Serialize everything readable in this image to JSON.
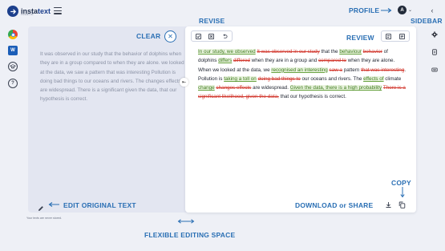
{
  "brand": {
    "name_a": "insta",
    "name_b": "text",
    "sub": "PREMIUM"
  },
  "header": {
    "profile_label": "PROFILE",
    "avatar_initial": "A",
    "sidebar_label": "SIDEBAR"
  },
  "editor": {
    "clear_label": "CLEAR",
    "original_text": "It was observed in our study that the behavior of dolphins when they are in a group compared to when they are alone. we looked at the data, we saw a pattern that was interesting Pollution is doing bad things to our oceans and rivers. The changes effects are widespread. There is a significant given the data, that our hypothesis is correct.",
    "edit_label": "EDIT ORIGINAL TEXT",
    "footnote": "Your texts are never stored.",
    "flex_label": "FLEXIBLE EDITING SPACE"
  },
  "review": {
    "revise_label": "REVISE",
    "review_label": "REVIEW",
    "copy_label": "COPY",
    "download_label": "DOWNLOAD or SHARE",
    "segments": [
      {
        "t": "In our study, we observed",
        "k": "add"
      },
      {
        "t": " ",
        "k": "n"
      },
      {
        "t": "It was observed in our study",
        "k": "del"
      },
      {
        "t": " that the ",
        "k": "n"
      },
      {
        "t": "behaviour",
        "k": "add"
      },
      {
        "t": " ",
        "k": "n"
      },
      {
        "t": "behavior",
        "k": "del"
      },
      {
        "t": " of dolphins ",
        "k": "n"
      },
      {
        "t": "differs",
        "k": "add"
      },
      {
        "t": " ",
        "k": "n"
      },
      {
        "t": "differed",
        "k": "del"
      },
      {
        "t": " when they are in a group and ",
        "k": "n"
      },
      {
        "t": "compared to",
        "k": "del"
      },
      {
        "t": " when they are alone. When we looked at the data, we ",
        "k": "n"
      },
      {
        "t": "recognised an interesting",
        "k": "add"
      },
      {
        "t": " ",
        "k": "n"
      },
      {
        "t": "saw a",
        "k": "del"
      },
      {
        "t": " pattern ",
        "k": "n"
      },
      {
        "t": "that was interesting",
        "k": "del"
      },
      {
        "t": ". Pollution is ",
        "k": "n"
      },
      {
        "t": "taking a toll on",
        "k": "add"
      },
      {
        "t": " ",
        "k": "n"
      },
      {
        "t": "doing bad things to",
        "k": "del"
      },
      {
        "t": " our oceans and rivers. The ",
        "k": "n"
      },
      {
        "t": "effects of",
        "k": "add"
      },
      {
        "t": " climate ",
        "k": "n"
      },
      {
        "t": "change",
        "k": "add"
      },
      {
        "t": " ",
        "k": "n"
      },
      {
        "t": "changes effects",
        "k": "del"
      },
      {
        "t": " are widespread. ",
        "k": "n"
      },
      {
        "t": "Given the data, there is a high probability",
        "k": "add"
      },
      {
        "t": " ",
        "k": "n"
      },
      {
        "t": "There is a significant likelihood, given the data,",
        "k": "del"
      },
      {
        "t": " that our hypothesis is correct.",
        "k": "n"
      }
    ]
  },
  "colors": {
    "accent": "#2a6fb4",
    "added": "#3d7a1c",
    "deleted": "#d1352b"
  }
}
